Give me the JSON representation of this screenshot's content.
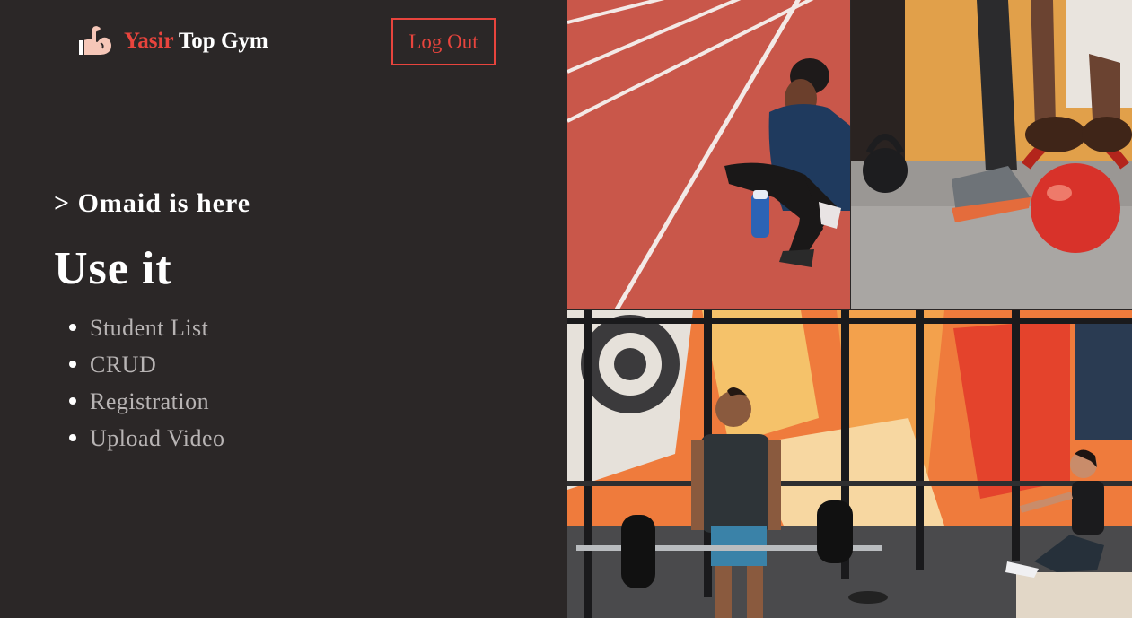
{
  "header": {
    "brand_first": "Yasir",
    "brand_rest": "Top Gym",
    "logout_label": "Log Out",
    "logo_icon": "flexed-arm-icon"
  },
  "hero": {
    "tagline": "> Omaid is here",
    "headline": "Use it",
    "menu": [
      {
        "label": "Student List"
      },
      {
        "label": "CRUD"
      },
      {
        "label": "Registration"
      },
      {
        "label": "Upload Video"
      }
    ]
  },
  "gallery": [
    {
      "subject": "woman-sitting-on-running-track-photo"
    },
    {
      "subject": "kettlebell-lifting-photo"
    },
    {
      "subject": "barbell-deadlift-in-gym-photo"
    }
  ],
  "colors": {
    "background": "#2b2727",
    "accent": "#e8443d",
    "menu_text": "#b8b4b4",
    "track": "#c9574a"
  }
}
